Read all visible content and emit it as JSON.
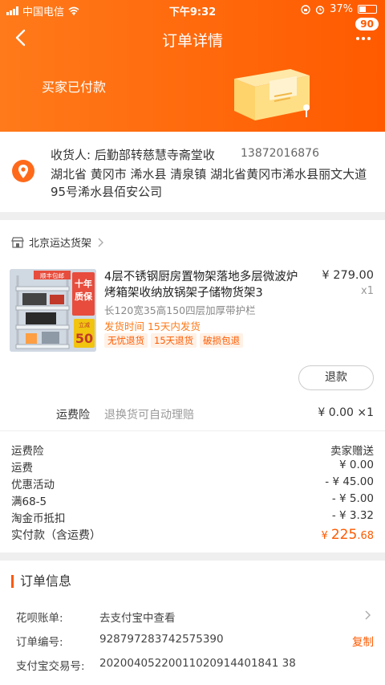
{
  "status_bar": {
    "carrier": "中国电信",
    "time": "下午9:32",
    "battery": "37%"
  },
  "nav": {
    "title": "订单详情",
    "message_count": "90"
  },
  "order_status": "买家已付款",
  "address": {
    "receiver": "收货人: 后勤部转慈慧寺斋堂收",
    "phone": "13872016876",
    "detail": "湖北省 黄冈市 浠水县 清泉镇  湖北省黄冈市浠水县丽文大道95号浠水县佰安公司"
  },
  "shop": {
    "name": "北京运达货架"
  },
  "product": {
    "title": "4层不锈钢厨房置物架落地多层微波炉烤箱架收纳放锅架子储物货架3",
    "price": "¥ 279.00",
    "qty": "x1",
    "spec": "长120宽35高150四层加厚带护栏",
    "ship_time": "发货时间  15天内发货",
    "tags": [
      "无忧退货",
      "15天退货",
      "破损包退"
    ],
    "img_badge_top": "顺丰包邮",
    "img_badge_main": "十年质保",
    "img_badge_num": "50",
    "img_badge_small": "立减"
  },
  "refund_label": "退款",
  "insurance": {
    "label": "运费险",
    "desc": "退换货可自动理赔",
    "value": "¥ 0.00 ×1"
  },
  "fees": [
    {
      "label": "运费险",
      "value": "卖家赠送"
    },
    {
      "label": "运费",
      "value": "¥ 0.00"
    },
    {
      "label": "优惠活动",
      "value": "- ¥ 45.00"
    },
    {
      "label": "满68-5",
      "value": "- ¥ 5.00"
    },
    {
      "label": "淘金币抵扣",
      "value": "- ¥ 3.32"
    }
  ],
  "paid": {
    "label": "实付款（含运费）",
    "currency": "¥ ",
    "int": "225",
    "dec": ".68"
  },
  "order_info": {
    "title": "订单信息",
    "rows": [
      {
        "key": "花呗账单:",
        "value": "去支付宝中查看"
      },
      {
        "key": "订单编号:",
        "value": "928797283742575390",
        "action": "复制"
      },
      {
        "key": "支付宝交易号:",
        "value": "20200405220011020914401841 38"
      }
    ]
  },
  "colors": {
    "accent": "#ff5a00",
    "header_start": "#ff7a1a"
  }
}
